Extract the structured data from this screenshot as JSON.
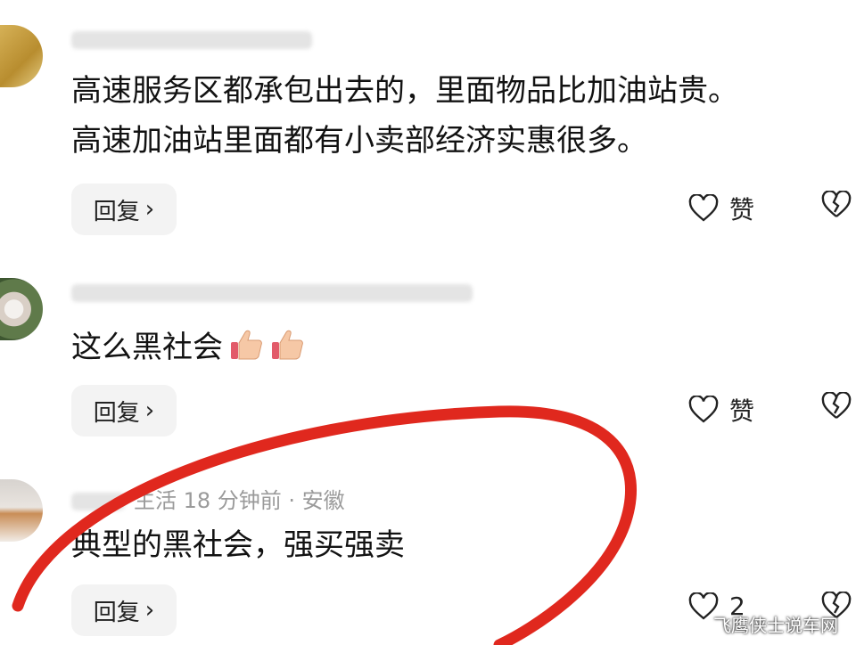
{
  "comments": [
    {
      "meta": "",
      "text": "高速服务区都承包出去的，里面物品比加油站贵。\n高速加油站里面都有小卖部经济实惠很多。",
      "reply_label": "回复",
      "like_label": "赞"
    },
    {
      "meta": "",
      "text": "这么黑社会",
      "reply_label": "回复",
      "like_label": "赞"
    },
    {
      "meta": "生活  18 分钟前 · 安徽",
      "text": "典型的黑社会，强买强卖",
      "reply_label": "回复",
      "like_label": "2"
    }
  ],
  "watermark": "飞鹰侠士说车网",
  "highlight_color": "#e0281e"
}
